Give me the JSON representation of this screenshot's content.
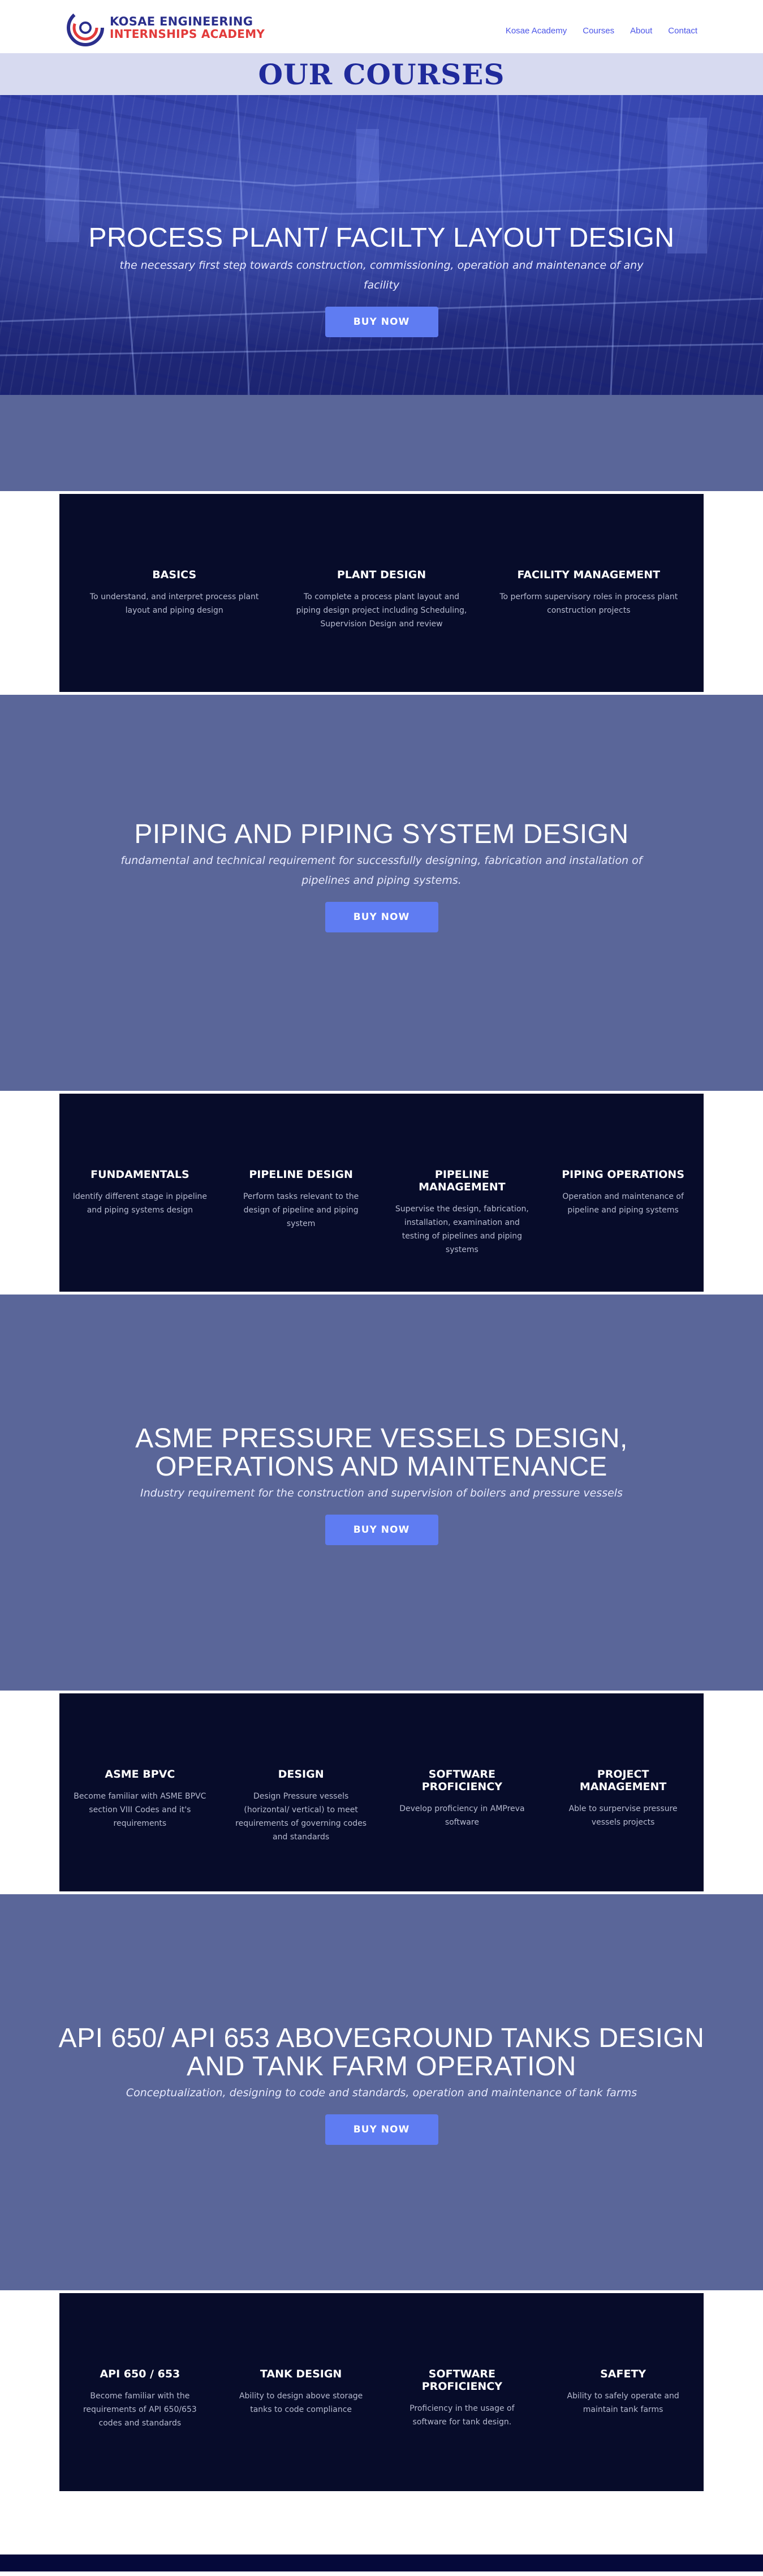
{
  "header": {
    "logo_line1": "KOSAE ENGINEERING",
    "logo_line2": "INTERNSHIPS ACADEMY",
    "nav": [
      "Kosae Academy",
      "Courses",
      "About",
      "Contact"
    ]
  },
  "page_title": "OUR COURSES",
  "colors": {
    "accent": "#5f7cf2",
    "panel": "#070c2a",
    "band": "#5a6699",
    "title": "#1f2a9b"
  },
  "courses": [
    {
      "title": "PROCESS PLANT/ FACILTY LAYOUT DESIGN",
      "subtitle": "the necessary first step towards construction, commissioning, operation and maintenance of any facility",
      "button": "BUY NOW",
      "features": [
        {
          "title": "BASICS",
          "text": "To understand, and interpret process plant layout and piping design"
        },
        {
          "title": "PLANT DESIGN",
          "text": "To complete a process plant layout and piping design project including Scheduling, Supervision Design and review"
        },
        {
          "title": "FACILITY MANAGEMENT",
          "text": "To perform supervisory roles in process plant construction projects"
        }
      ]
    },
    {
      "title": "PIPING AND PIPING SYSTEM DESIGN",
      "subtitle": "fundamental and technical requirement for successfully designing, fabrication and installation of pipelines and piping systems.",
      "button": "BUY NOW",
      "features": [
        {
          "title": "FUNDAMENTALS",
          "text": "Identify different stage in pipeline and piping systems design"
        },
        {
          "title": "PIPELINE DESIGN",
          "text": "Perform tasks relevant to the design of pipeline and piping system"
        },
        {
          "title": "PIPELINE MANAGEMENT",
          "text": "Supervise the design, fabrication, installation, examination and testing of pipelines and piping systems"
        },
        {
          "title": "PIPING OPERATIONS",
          "text": "Operation and maintenance of pipeline and piping systems"
        }
      ]
    },
    {
      "title": "ASME PRESSURE VESSELS DESIGN, OPERATIONS AND MAINTENANCE",
      "subtitle": "Industry requirement for the construction and supervision of boilers and pressure vessels",
      "button": "BUY NOW",
      "features": [
        {
          "title": "ASME BPVC",
          "text": "Become familiar with ASME BPVC section VIII Codes and it's requirements"
        },
        {
          "title": "DESIGN",
          "text": "Design Pressure vessels (horizontal/ vertical) to meet requirements of governing codes and standards"
        },
        {
          "title": "SOFTWARE PROFICIENCY",
          "text": "Develop proficiency in AMPreva software"
        },
        {
          "title": "PROJECT MANAGEMENT",
          "text": "Able to surpervise pressure vessels projects"
        }
      ]
    },
    {
      "title": "API 650/ API 653 ABOVEGROUND TANKS DESIGN AND TANK FARM OPERATION",
      "subtitle": "Conceptualization, designing to code and standards, operation and maintenance of tank farms",
      "button": "BUY NOW",
      "features": [
        {
          "title": "API 650 / 653",
          "text": "Become familiar with the requirements of API 650/653 codes and standards"
        },
        {
          "title": "TANK DESIGN",
          "text": "Ability to design above storage tanks to code compliance"
        },
        {
          "title": "SOFTWARE PROFICIENCY",
          "text": "Proficiency in the usage of software for tank design."
        },
        {
          "title": "SAFETY",
          "text": "Ability to safely operate and maintain tank farms"
        }
      ]
    }
  ]
}
